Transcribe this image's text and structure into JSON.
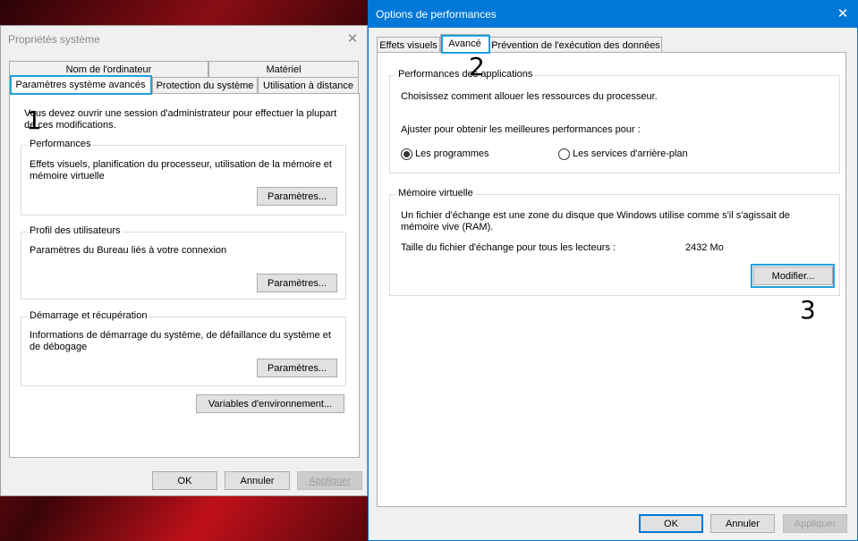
{
  "system_props": {
    "title": "Propriétés système",
    "tabs_row1": [
      "Nom de l'ordinateur",
      "Matériel"
    ],
    "tabs_row2": [
      "Paramètres système avancés",
      "Protection du système",
      "Utilisation à distance"
    ],
    "admin_note": "Vous devez ouvrir une session d'administrateur pour effectuer la plupart de ces modifications.",
    "groups": [
      {
        "label": "Performances",
        "desc": "Effets visuels, planification du processeur, utilisation de la mémoire et mémoire virtuelle",
        "button": "Paramètres..."
      },
      {
        "label": "Profil des utilisateurs",
        "desc": "Paramètres du Bureau liés à votre connexion",
        "button": "Paramètres..."
      },
      {
        "label": "Démarrage et récupération",
        "desc": "Informations de démarrage du système, de défaillance du système et de débogage",
        "button": "Paramètres..."
      }
    ],
    "env_button": "Variables d'environnement...",
    "ok": "OK",
    "cancel": "Annuler",
    "apply": "Appliquer"
  },
  "perf_options": {
    "title": "Options de performances",
    "tabs": [
      "Effets visuels",
      "Avancé",
      "Prévention de l'exécution des données"
    ],
    "app_perf": {
      "label": "Performances des applications",
      "desc": "Choisissez comment allouer les ressources du processeur.",
      "adjust": "Ajuster pour obtenir les meilleures performances pour :",
      "radio_programs": "Les programmes",
      "radio_services": "Les services d'arrière-plan",
      "selected": "Les programmes"
    },
    "virtual_memory": {
      "label": "Mémoire virtuelle",
      "desc": "Un fichier d'échange est une zone du disque que Windows utilise comme s'il s'agissait de mémoire vive (RAM).",
      "size_label": "Taille du fichier d'échange pour tous les lecteurs :",
      "size_value": "2432 Mo",
      "modify": "Modifier..."
    },
    "ok": "OK",
    "cancel": "Annuler",
    "apply": "Appliquer"
  },
  "annotations": [
    "1",
    "2",
    "3"
  ],
  "colors": {
    "highlight": "#1ea2de",
    "default_button": "#0078d7"
  }
}
